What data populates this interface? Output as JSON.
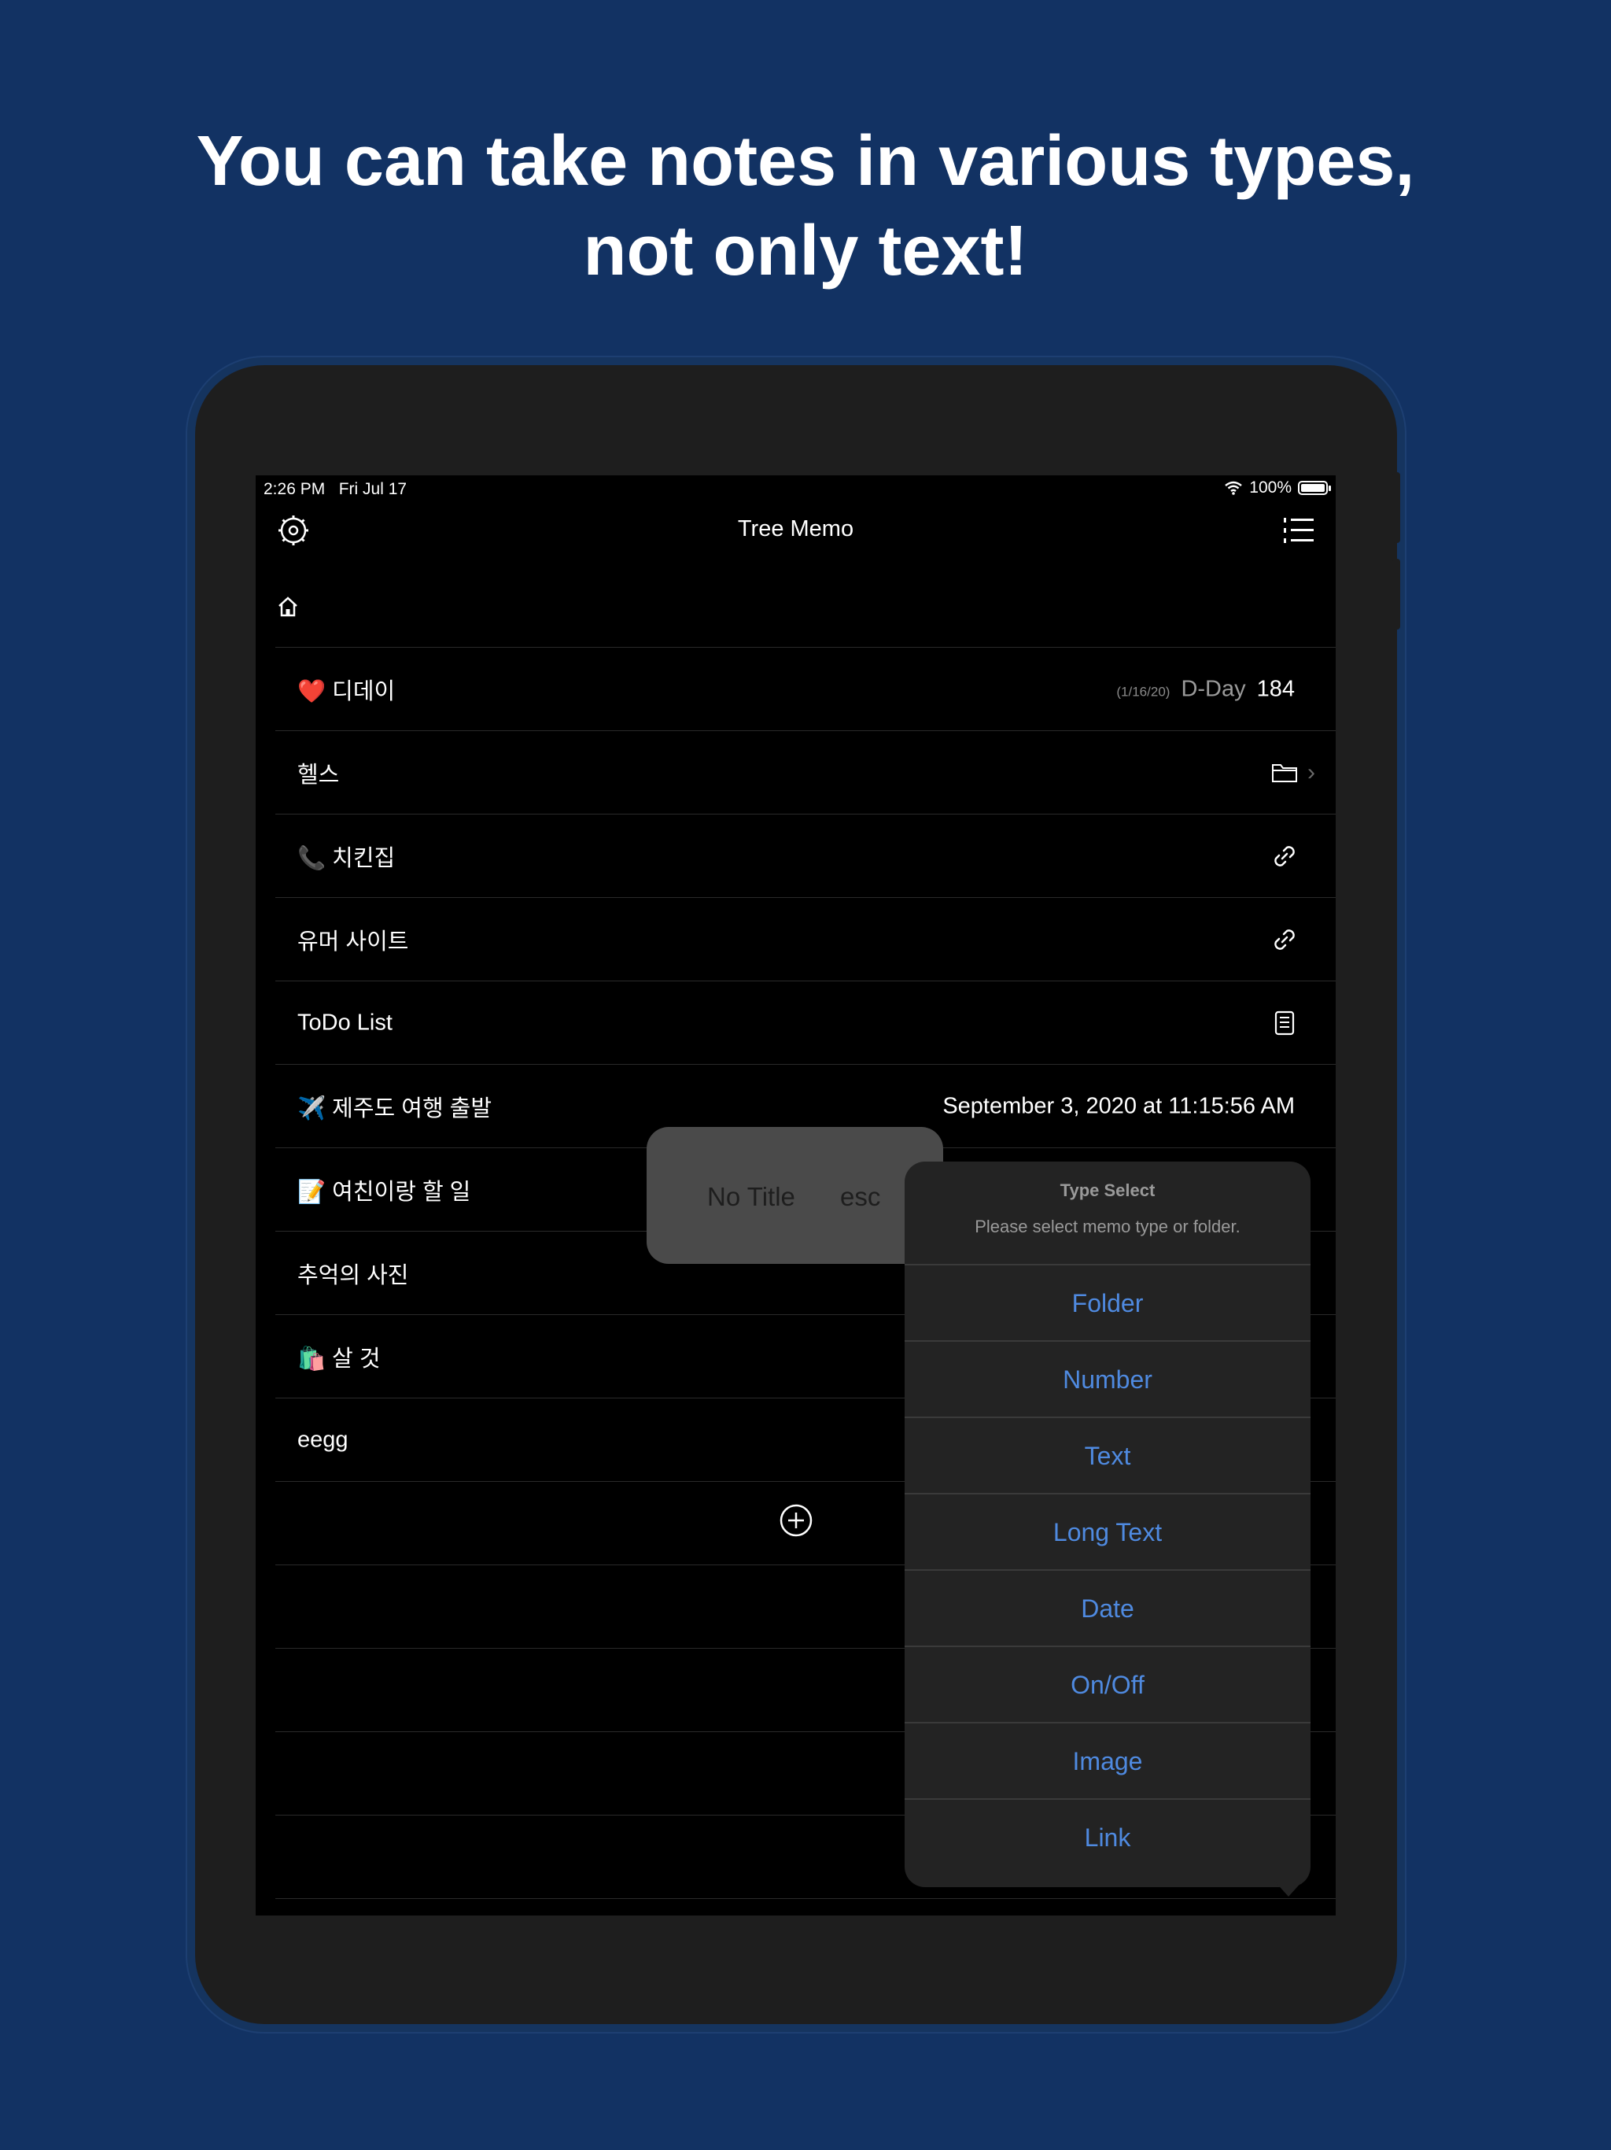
{
  "headline": {
    "line1": "You can take notes in various types,",
    "line2": "not only text!"
  },
  "status_bar": {
    "time": "2:26 PM",
    "date": "Fri Jul 17",
    "battery": "100%"
  },
  "nav": {
    "title": "Tree Memo",
    "left_icon": "settings-icon",
    "right_icon": "list-icon"
  },
  "rows": [
    {
      "emoji": "❤️",
      "label": "디데이",
      "dday_date": "(1/16/20)",
      "dday_label": "D-Day",
      "dday_value": "184"
    },
    {
      "label": "헬스",
      "icon": "folder-icon"
    },
    {
      "emoji": "📞",
      "label": "치킨집",
      "icon": "link-icon"
    },
    {
      "label": "유머 사이트",
      "icon": "link-icon"
    },
    {
      "label": "ToDo List",
      "icon": "document-icon"
    },
    {
      "emoji": "✈️",
      "label": "제주도 여행 출발",
      "value": "September 3, 2020 at 11:15:56 AM"
    },
    {
      "emoji": "📝",
      "label": "여친이랑 할 일"
    },
    {
      "label": "추억의 사진"
    },
    {
      "emoji": "🛍️",
      "label": "살 것"
    },
    {
      "label": "eegg"
    }
  ],
  "title_popup": {
    "title": "No Title",
    "esc": "esc"
  },
  "type_select": {
    "title": "Type Select",
    "subtitle": "Please select memo type or folder.",
    "options": [
      "Folder",
      "Number",
      "Text",
      "Long Text",
      "Date",
      "On/Off",
      "Image",
      "Link"
    ]
  },
  "colors": {
    "background": "#123263",
    "accent": "#4f8ae0"
  }
}
